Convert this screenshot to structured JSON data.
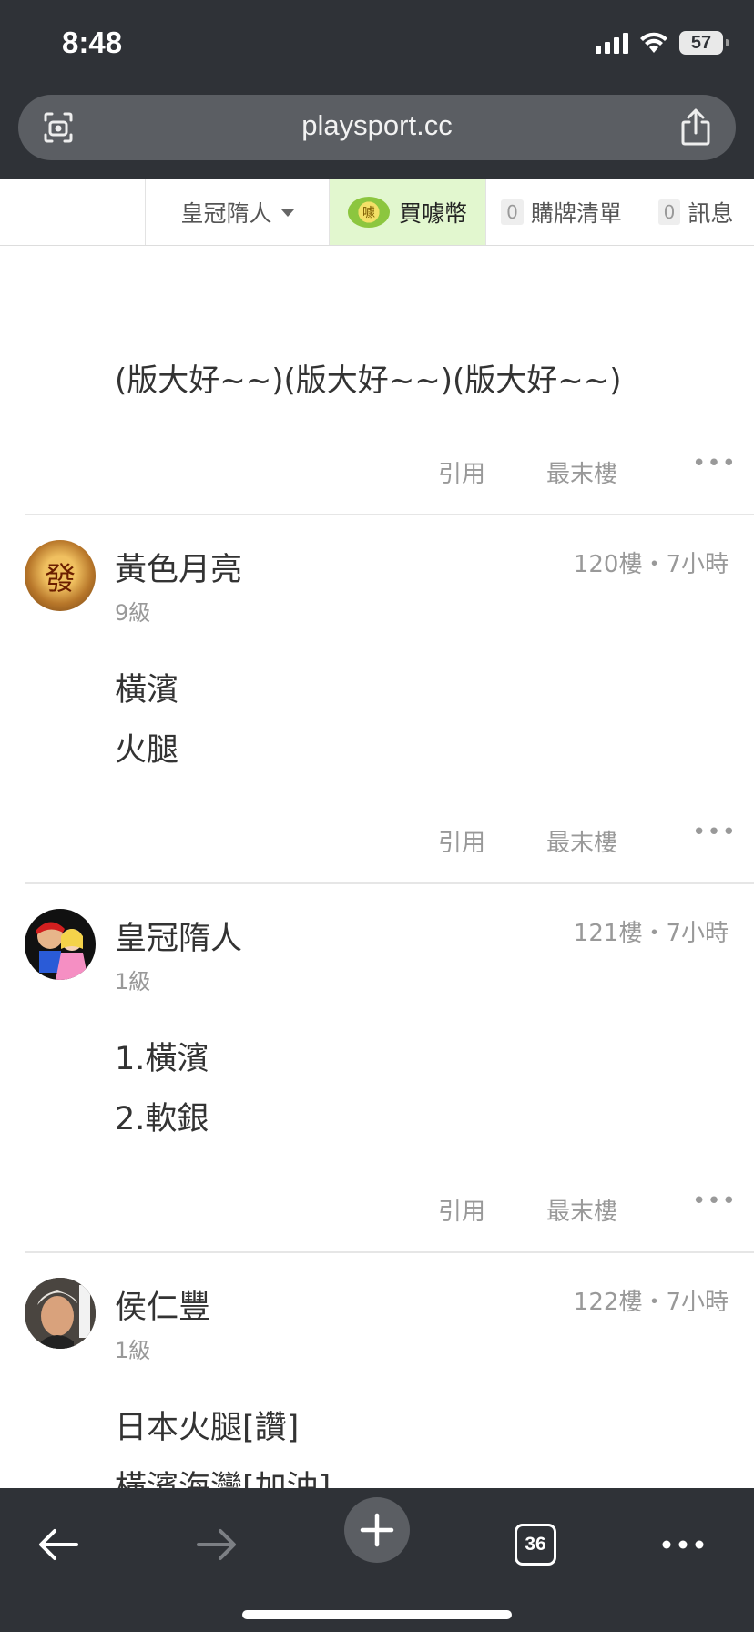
{
  "status_bar": {
    "time": "8:48",
    "battery": "57"
  },
  "browser": {
    "url": "playsport.cc",
    "tab_count": "36"
  },
  "site_nav": {
    "user_name": "皇冠隋人",
    "coin_label": "買噱幣",
    "coin_badge": "噱",
    "cart_count": "0",
    "cart_label": "購牌清單",
    "msg_count": "0",
    "msg_label": "訊息"
  },
  "previous_post": {
    "body": "(版大好~~)(版大好~~)(版大好~~)"
  },
  "actions": {
    "quote": "引用",
    "last_floor": "最末樓",
    "more": "•••"
  },
  "posts": [
    {
      "author": "黃色月亮",
      "level": "9級",
      "meta": "120樓・7小時",
      "lines": [
        "橫濱",
        "火腿"
      ],
      "avatar_char": "發"
    },
    {
      "author": "皇冠隋人",
      "level": "1級",
      "meta": "121樓・7小時",
      "lines": [
        "1.橫濱",
        "2.軟銀"
      ]
    },
    {
      "author": "侯仁豐",
      "level": "1級",
      "meta": "122樓・7小時",
      "lines": [
        "日本火腿[讚]",
        "橫濱海灣[加油]"
      ]
    }
  ],
  "colors": {
    "chrome": "#2f3237",
    "url_bar": "#5b5e63",
    "coin_bg": "#e2f7cf"
  }
}
